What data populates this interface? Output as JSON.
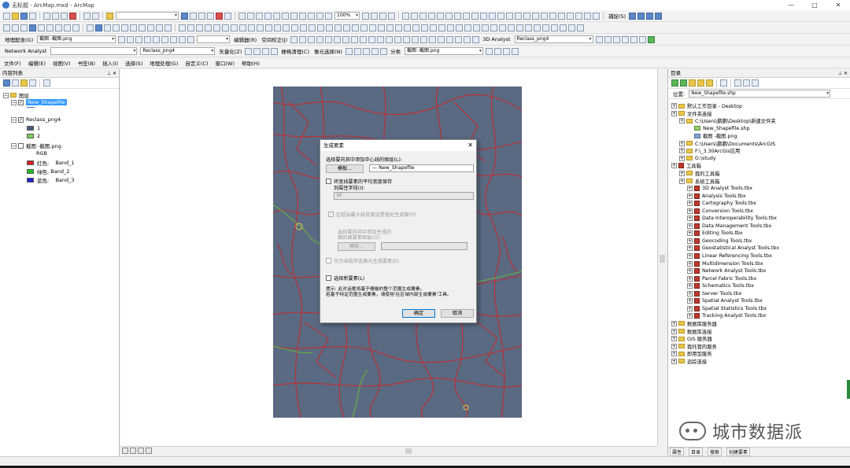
{
  "window": {
    "title": "无标题 - ArcMap.mxd - ArcMap",
    "controls": [
      "—",
      "□",
      "✕"
    ]
  },
  "toolbar1": {
    "scale_combo": "",
    "zoom_combo": "100%",
    "editor_label": "捕捉(S)"
  },
  "toolbar2": {
    "layout_label": "地理配准(G)",
    "layer_combo": "截图 -截图.png",
    "editor_label": "编辑器(R)",
    "spatial_adjust_label": "空间校正(J)",
    "analyst_label": "3D Analyst",
    "analyst_layer": "Reclass_png4"
  },
  "toolbar3": {
    "network_label": "Network Analyst",
    "reclass_combo": "Reclass_png4",
    "vectorize_label": "矢量化(Z)",
    "raster_clean_label": "栅格清理(C)",
    "cell_select_label": "像元选择(N)",
    "classify_label": "分类",
    "classify_layer": "截图 -截图.png"
  },
  "menubar": [
    "文件(F)",
    "编辑(E)",
    "视图(V)",
    "书签(B)",
    "插入(I)",
    "选择(S)",
    "地理处理(G)",
    "自定义(C)",
    "窗口(W)",
    "帮助(H)"
  ],
  "toc": {
    "title": "内容列表",
    "root": "图层",
    "layers": [
      {
        "name": "New_Shapefile",
        "selected": true
      },
      {
        "name": "Reclass_png4",
        "items": [
          {
            "label": "1",
            "color": "#4a5a7a"
          },
          {
            "label": "2",
            "color": "#7bd15c"
          }
        ]
      },
      {
        "name": "截图 -截图.png",
        "rgb": "RGB",
        "bands": [
          {
            "label": "红色:",
            "band": "Band_1",
            "color": "#e02020"
          },
          {
            "label": "绿色:",
            "band": "Band_2",
            "color": "#20c020"
          },
          {
            "label": "蓝色:",
            "band": "Band_3",
            "color": "#2020d0"
          }
        ]
      }
    ]
  },
  "dialog": {
    "title": "生成要素",
    "close": "✕",
    "select_layer_label": "选择要向其中添加中心线的图层(L):",
    "template_button": "模板...",
    "template_value": "— New_Shapefile",
    "save_avg_label": "将宽线要素的平均宽度保存",
    "to_field_label": "到属性字段(I):",
    "field_value": "bf",
    "gen_polygons_label": "在超出最大线宽度设置值处生成面(P)",
    "select_polygon_label": "选择要向其中添加生成的",
    "select_polygon_label2": "面的面要素图层(O):",
    "template_button2": "模板...",
    "template_value2": "",
    "only_selection_label": "仅为当前所选像元生成要素(E)",
    "select_features_label": "选择新要素(L)",
    "hint1": "提示: 此对话框将基于栅格的整个范围生成要素。",
    "hint2": "若基于特定范围生成要素，请使用'在区域内部生成要素'工具。",
    "ok_button": "确定",
    "cancel_button": "取消"
  },
  "catalog": {
    "title": "目录",
    "location_label": "位置:",
    "location_value": "New_Shapefile.shp",
    "tree": [
      {
        "depth": 0,
        "text": "默认工作目录 - Desktop",
        "type": "folder"
      },
      {
        "depth": 0,
        "text": "文件夹连接",
        "type": "folder"
      },
      {
        "depth": 1,
        "text": "C:\\Users\\鹏鹏\\Desktop\\新建文件夹",
        "type": "folder"
      },
      {
        "depth": 2,
        "text": "New_Shapefile.shp",
        "type": "shp"
      },
      {
        "depth": 2,
        "text": "截图 -截图.png",
        "type": "raster"
      },
      {
        "depth": 1,
        "text": "C:\\Users\\鹏鹏\\Documents\\ArcGIS",
        "type": "folder"
      },
      {
        "depth": 1,
        "text": "F:\\_3.30ArcGis应用",
        "type": "folder"
      },
      {
        "depth": 1,
        "text": "G:\\study",
        "type": "folder"
      },
      {
        "depth": 0,
        "text": "工具箱",
        "type": "tool"
      },
      {
        "depth": 1,
        "text": "我的工具箱",
        "type": "folder"
      },
      {
        "depth": 1,
        "text": "系统工具箱",
        "type": "folder"
      },
      {
        "depth": 2,
        "text": "3D Analyst Tools.tbx",
        "type": "tool"
      },
      {
        "depth": 2,
        "text": "Analysis Tools.tbx",
        "type": "tool"
      },
      {
        "depth": 2,
        "text": "Cartography Tools.tbx",
        "type": "tool"
      },
      {
        "depth": 2,
        "text": "Conversion Tools.tbx",
        "type": "tool"
      },
      {
        "depth": 2,
        "text": "Data Interoperability Tools.tbx",
        "type": "tool"
      },
      {
        "depth": 2,
        "text": "Data Management Tools.tbx",
        "type": "tool"
      },
      {
        "depth": 2,
        "text": "Editing Tools.tbx",
        "type": "tool"
      },
      {
        "depth": 2,
        "text": "Geocoding Tools.tbx",
        "type": "tool"
      },
      {
        "depth": 2,
        "text": "Geostatistical Analyst Tools.tbx",
        "type": "tool"
      },
      {
        "depth": 2,
        "text": "Linear Referencing Tools.tbx",
        "type": "tool"
      },
      {
        "depth": 2,
        "text": "Multidimension Tools.tbx",
        "type": "tool"
      },
      {
        "depth": 2,
        "text": "Network Analyst Tools.tbx",
        "type": "tool"
      },
      {
        "depth": 2,
        "text": "Parcel Fabric Tools.tbx",
        "type": "tool"
      },
      {
        "depth": 2,
        "text": "Schematics Tools.tbx",
        "type": "tool"
      },
      {
        "depth": 2,
        "text": "Server Tools.tbx",
        "type": "tool"
      },
      {
        "depth": 2,
        "text": "Spatial Analyst Tools.tbx",
        "type": "tool"
      },
      {
        "depth": 2,
        "text": "Spatial Statistics Tools.tbx",
        "type": "tool"
      },
      {
        "depth": 2,
        "text": "Tracking Analyst Tools.tbx",
        "type": "tool"
      },
      {
        "depth": 0,
        "text": "数据库服务器",
        "type": "folder"
      },
      {
        "depth": 0,
        "text": "数据库连接",
        "type": "folder"
      },
      {
        "depth": 0,
        "text": "GIS 服务器",
        "type": "folder"
      },
      {
        "depth": 0,
        "text": "我托管的服务",
        "type": "folder"
      },
      {
        "depth": 0,
        "text": "即用型服务",
        "type": "folder"
      },
      {
        "depth": 0,
        "text": "追踪连接",
        "type": "folder"
      }
    ],
    "tabs": [
      "属性",
      "目录",
      "搜索",
      "创建要素"
    ]
  },
  "watermark": "城市数据派",
  "colors": {
    "map_background": "#5a6a82",
    "road_red": "#d42020",
    "road_green": "#6dbb3a",
    "selection": "#3399ff"
  }
}
